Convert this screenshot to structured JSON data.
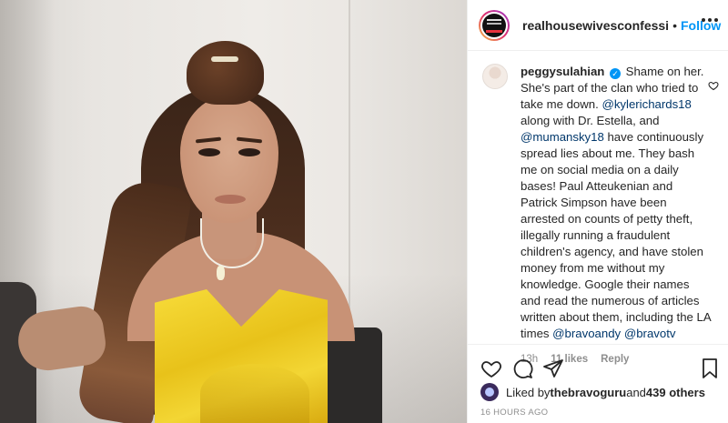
{
  "post": {
    "photo_alt_icon": "photo"
  },
  "header": {
    "username": "realhousewivesconfessi",
    "separator": "•",
    "follow_label": "Follow",
    "more_icon": "more-horizontal-icon"
  },
  "comment": {
    "username": "peggysulahian",
    "verified_mark": "✓",
    "segments": {
      "t1": " Shame on her. She's part of the clan who tried to take me down. ",
      "m1": "@kylerichards18",
      "t2": " along with Dr. Estella, and ",
      "m2": "@mumansky18",
      "t3": " have continuously spread lies about me. They bash me on social media on a daily bases! Paul Atteukenian and Patrick Simpson have been arrested on counts of petty theft, illegally running a fraudulent children's agency, and have stolen money from me without my knowledge. Google their names and read the numerous of articles written about them, including the LA times ",
      "m3": "@bravoandy",
      "t4": " ",
      "m4": "@bravotv"
    },
    "time": "13h",
    "likes": "11 likes",
    "reply": "Reply"
  },
  "actions": {
    "like_icon": "heart-icon",
    "comment_icon": "comment-icon",
    "share_icon": "paper-plane-icon",
    "save_icon": "bookmark-icon"
  },
  "likes": {
    "prefix": "Liked by ",
    "user": "thebravoguru",
    "middle": " and ",
    "others": "439 others"
  },
  "timestamp": "16 HOURS AGO"
}
